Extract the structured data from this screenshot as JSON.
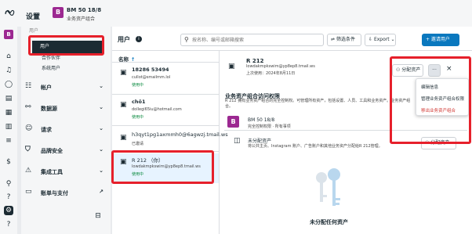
{
  "header": {
    "settings_title": "设置",
    "biz_avatar": "B",
    "biz_name": "BM 50 18/8",
    "biz_sub": "业务资产组合"
  },
  "rail": {
    "avatar": "B",
    "icons": [
      "home-icon",
      "bell-icon",
      "chat-icon",
      "bookmark-icon",
      "table-icon",
      "chart-icon",
      "menu-icon",
      "dollar-icon",
      "search-icon",
      "help-icon",
      "settings-icon"
    ]
  },
  "sidebar": {
    "top_cut_label": "用户",
    "selected": "用户",
    "items": [
      "合作伙伴",
      "系统用户"
    ],
    "sections": [
      {
        "icon": "user-group-icon",
        "label": "帐户"
      },
      {
        "icon": "database-icon",
        "label": "数据源"
      },
      {
        "icon": "user-plus-icon",
        "label": "请求"
      },
      {
        "icon": "shield-icon",
        "label": "品牌安全"
      },
      {
        "icon": "integration-icon",
        "label": "集成工具"
      },
      {
        "icon": "billing-icon",
        "label": "账单与支付"
      }
    ]
  },
  "main": {
    "title": "用户",
    "info_glyph": "i",
    "search_placeholder": "按名称、编号或邮箱搜索",
    "filter_label": "筛选条件",
    "export_label": "Export",
    "add_user_label": "+ 邀请用户",
    "column_header": "名称",
    "sort_arrow": "↑"
  },
  "users": [
    {
      "name": "18286 53494",
      "email": "cullot@smailmm.lol",
      "status": "使用中",
      "status_color": "#0a8a3f"
    },
    {
      "name": "chô1",
      "email": "dollegi65iu@hotmail.com",
      "status": "使用中",
      "status_color": "#0a8a3f"
    },
    {
      "name": "h3qyt1pg1axmmh0@6agwzj.tmail.ws",
      "email": "",
      "status": "已邀请",
      "status_color": "#444444"
    },
    {
      "name": "R 212 （你）",
      "email": "lowdakmpkswim@yp8ep8.tmail.ws",
      "status": "使用中",
      "status_color": "#0a8a3f"
    }
  ],
  "detail": {
    "name": "R 212",
    "email": "lowdakmpkswim@yp8ep8.tmail.ws",
    "last_active": "上次使用：2024年8月11日",
    "assign_btn": "分配资产",
    "more_btn": "···",
    "close_btn": "×",
    "section_title": "业务资产组合访问权限",
    "section_desc": "R 212 拥有业务资产组合的完全控制权。可管理所有资产，包括设置、人员、工具和业务资产。业务资产组合。",
    "asset_avatar": "B",
    "asset_name": "BM 50 18/8",
    "asset_perm": "完全控制权限 · 所有事项",
    "unassigned_title": "未分配资产",
    "unassigned_desc": "将公共主页、Instagram 账户、广告账户和其他业务资产分配给R 212管理。",
    "unassigned_btn": "分配资产",
    "empty_title": "未分配任何资产"
  },
  "dropdown": {
    "items": [
      {
        "label": "编辑信息",
        "danger": false
      },
      {
        "label": "管理业务资产组合权限",
        "danger": false
      },
      {
        "label": "移出业务资产组合",
        "danger": true
      }
    ]
  },
  "annotation_color": "#e6202b"
}
